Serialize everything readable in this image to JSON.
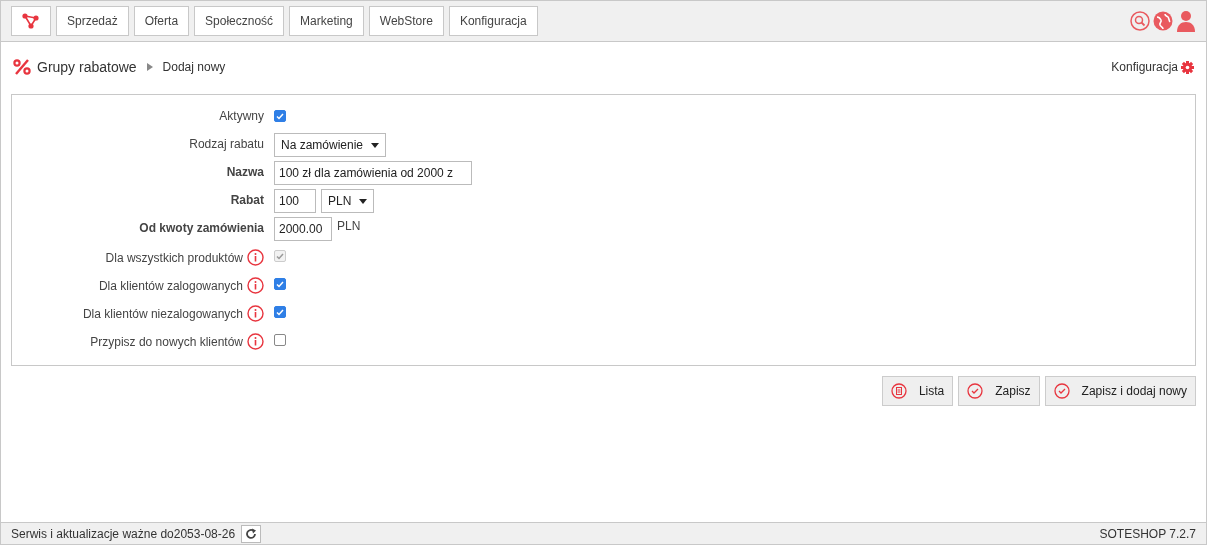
{
  "top_nav": {
    "items": [
      {
        "label": "Sprzedaż"
      },
      {
        "label": "Oferta"
      },
      {
        "label": "Społeczność"
      },
      {
        "label": "Marketing"
      },
      {
        "label": "WebStore"
      },
      {
        "label": "Konfiguracja"
      }
    ]
  },
  "breadcrumb": {
    "title": "Grupy rabatowe",
    "current": "Dodaj nowy",
    "config_link": "Konfiguracja"
  },
  "form": {
    "fields": [
      {
        "kind": "checkbox",
        "label": "Aktywny",
        "bold": false,
        "info": false,
        "checked": true,
        "disabled": false
      },
      {
        "kind": "select",
        "label": "Rodzaj rabatu",
        "bold": false,
        "info": false,
        "value": "Na zamówienie"
      },
      {
        "kind": "text",
        "label": "Nazwa",
        "bold": true,
        "info": false,
        "value": "100 zł dla zamówienia od 2000 z"
      },
      {
        "kind": "amount_select",
        "label": "Rabat",
        "bold": true,
        "info": false,
        "value": "100",
        "unit": "PLN"
      },
      {
        "kind": "amount",
        "label": "Od kwoty zamówienia",
        "bold": true,
        "info": false,
        "value": "2000.00",
        "unit": "PLN"
      },
      {
        "kind": "checkbox",
        "label": "Dla wszystkich produktów",
        "bold": false,
        "info": true,
        "checked": true,
        "disabled": true
      },
      {
        "kind": "checkbox",
        "label": "Dla klientów zalogowanych",
        "bold": false,
        "info": true,
        "checked": true,
        "disabled": false
      },
      {
        "kind": "checkbox",
        "label": "Dla klientów niezalogowanych",
        "bold": false,
        "info": true,
        "checked": true,
        "disabled": false
      },
      {
        "kind": "checkbox",
        "label": "Przypisz do nowych klientów",
        "bold": false,
        "info": true,
        "checked": false,
        "disabled": false
      }
    ]
  },
  "actions": [
    {
      "kind": "list",
      "label": "Lista"
    },
    {
      "kind": "save",
      "label": "Zapisz"
    },
    {
      "kind": "save",
      "label": "Zapisz i dodaj nowy"
    }
  ],
  "status_bar": {
    "text": "Serwis i aktualizacje ważne do2053-08-26",
    "version": "SOTESHOP 7.2.7"
  }
}
